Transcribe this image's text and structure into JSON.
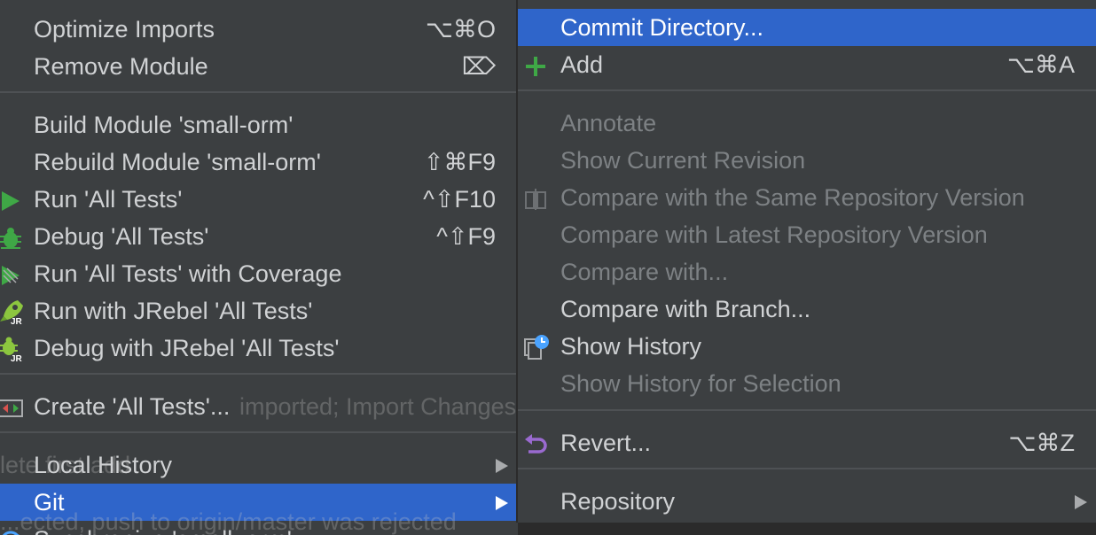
{
  "left_menu": {
    "items": [
      {
        "label": "Optimize Imports",
        "shortcut": "⌥⌘O"
      },
      {
        "label": "Remove Module",
        "shortcut": "⌦"
      },
      {
        "label": "Build Module 'small-orm'",
        "shortcut": ""
      },
      {
        "label": "Rebuild Module 'small-orm'",
        "shortcut": "⇧⌘F9"
      },
      {
        "label": "Run 'All Tests'",
        "shortcut": "^⇧F10",
        "icon": "run-icon"
      },
      {
        "label": "Debug 'All Tests'",
        "shortcut": "^⇧F9",
        "icon": "debug-bug-icon"
      },
      {
        "label": "Run 'All Tests' with Coverage",
        "shortcut": "",
        "icon": "run-coverage-icon"
      },
      {
        "label": "Run with JRebel 'All Tests'",
        "shortcut": "",
        "icon": "jrebel-rocket-icon"
      },
      {
        "label": "Debug with JRebel 'All Tests'",
        "shortcut": "",
        "icon": "jrebel-debug-icon"
      },
      {
        "label": "Create 'All Tests'...",
        "shortcut": "",
        "icon": "run-config-icon"
      },
      {
        "label": "Local History",
        "shortcut": ""
      },
      {
        "label": "Git",
        "shortcut": "",
        "selected": true
      },
      {
        "label": "Synchronize 'small_orm'",
        "shortcut": "",
        "icon": "sync-icon"
      }
    ]
  },
  "right_menu": {
    "items": [
      {
        "label": "Commit Directory...",
        "shortcut": "",
        "selected": true
      },
      {
        "label": "Add",
        "shortcut": "⌥⌘A",
        "icon": "plus-icon"
      },
      {
        "label": "Annotate",
        "shortcut": "",
        "disabled": true
      },
      {
        "label": "Show Current Revision",
        "shortcut": "",
        "disabled": true
      },
      {
        "label": "Compare with the Same Repository Version",
        "shortcut": "",
        "disabled": true,
        "icon": "compare-icon"
      },
      {
        "label": "Compare with Latest Repository Version",
        "shortcut": "",
        "disabled": true
      },
      {
        "label": "Compare with...",
        "shortcut": "",
        "disabled": true
      },
      {
        "label": "Compare with Branch...",
        "shortcut": ""
      },
      {
        "label": "Show History",
        "shortcut": "",
        "icon": "history-clock-icon"
      },
      {
        "label": "Show History for Selection",
        "shortcut": "",
        "disabled": true
      },
      {
        "label": "Revert...",
        "shortcut": "⌥⌘Z",
        "icon": "revert-arrow-icon"
      },
      {
        "label": "Repository",
        "shortcut": ""
      }
    ]
  },
  "background": {
    "ghost_line_1": "imported; Import Changes   Enable Auto-Import",
    "ghost_line_2": "lete  first add",
    "ghost_line_3": "...ected, push to origin/master was rejected"
  },
  "colors": {
    "menu_bg": "#3c3f41",
    "selection": "#2f65ca",
    "text": "#d0d2d4",
    "disabled_text": "#7d8184",
    "separator": "#4e5154",
    "green": "#3fa846",
    "purple": "#9a6ad0",
    "blue_clock": "#4aa3ff"
  }
}
